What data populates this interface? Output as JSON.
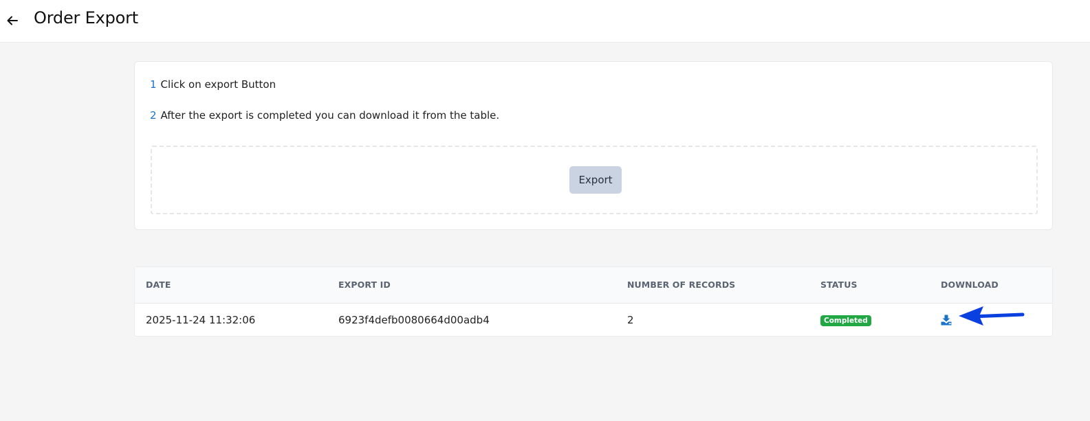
{
  "header": {
    "title": "Order Export",
    "back_icon": "arrow-left-icon"
  },
  "instructions": {
    "steps": [
      {
        "num": "1",
        "text": "Click on export Button"
      },
      {
        "num": "2",
        "text": "After the export is completed you can download it from the table."
      }
    ],
    "export_label": "Export"
  },
  "table": {
    "columns": [
      "DATE",
      "EXPORT ID",
      "NUMBER OF RECORDS",
      "STATUS",
      "DOWNLOAD"
    ],
    "rows": [
      {
        "date": "2025-11-24 11:32:06",
        "export_id": "6923f4defb0080664d00adb4",
        "records": "2",
        "status": "Completed",
        "download_icon": "download-icon"
      }
    ]
  },
  "colors": {
    "accent": "#1a73c9",
    "status_completed": "#22a745",
    "annotation_arrow": "#0a3fe0"
  }
}
